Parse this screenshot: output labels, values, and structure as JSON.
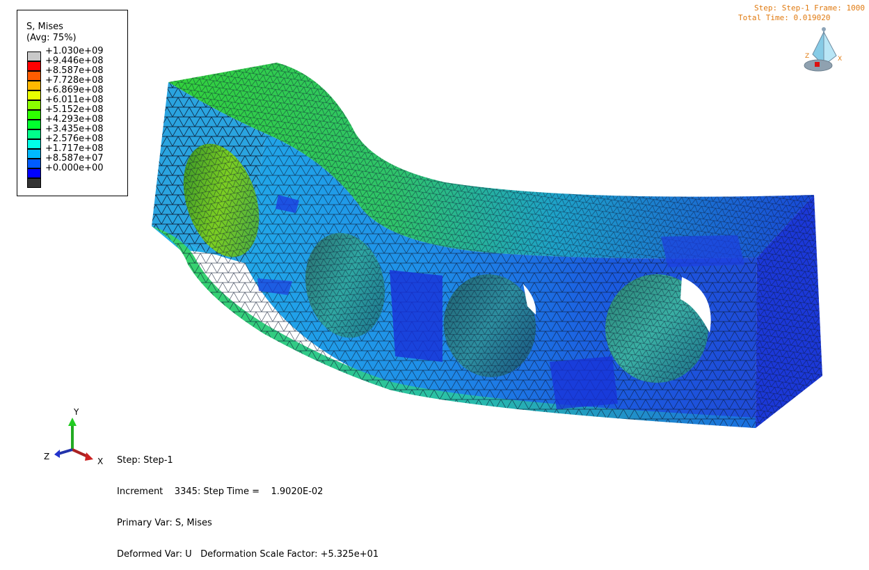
{
  "legend": {
    "title": "S, Mises",
    "subtitle": "(Avg: 75%)",
    "entries": [
      {
        "label": "+1.030e+09",
        "color": "#c8c8c8"
      },
      {
        "label": "+9.446e+08",
        "color": "#ff0000"
      },
      {
        "label": "+8.587e+08",
        "color": "#ff5c00"
      },
      {
        "label": "+7.728e+08",
        "color": "#ffb900"
      },
      {
        "label": "+6.869e+08",
        "color": "#e8ff00"
      },
      {
        "label": "+6.011e+08",
        "color": "#8bff00"
      },
      {
        "label": "+5.152e+08",
        "color": "#2eff00"
      },
      {
        "label": "+4.293e+08",
        "color": "#00ff2e"
      },
      {
        "label": "+3.435e+08",
        "color": "#00ff8b"
      },
      {
        "label": "+2.576e+08",
        "color": "#00ffe8"
      },
      {
        "label": "+1.717e+08",
        "color": "#00b9ff"
      },
      {
        "label": "+8.587e+07",
        "color": "#005cff"
      },
      {
        "label": "+0.000e+00",
        "color": "#0000ff"
      }
    ],
    "below_min_color": "#333333"
  },
  "hud": {
    "step_frame": "Step: Step-1    Frame: 1000",
    "total_time": "Total Time: 0.019020"
  },
  "info": {
    "step": "Step: Step-1",
    "increment": "Increment    3345: Step Time =    1.9020E-02",
    "primary_var": "Primary Var: S, Mises",
    "deformed_var": "Deformed Var: U   Deformation Scale Factor: +5.325e+01"
  },
  "triad": {
    "x": "X",
    "y": "Y",
    "z": "Z"
  },
  "view_cube": {
    "x": "X",
    "z": "Z"
  },
  "colors": {
    "accent_hud": "#e07a10",
    "mesh_line": "#0a1630"
  }
}
